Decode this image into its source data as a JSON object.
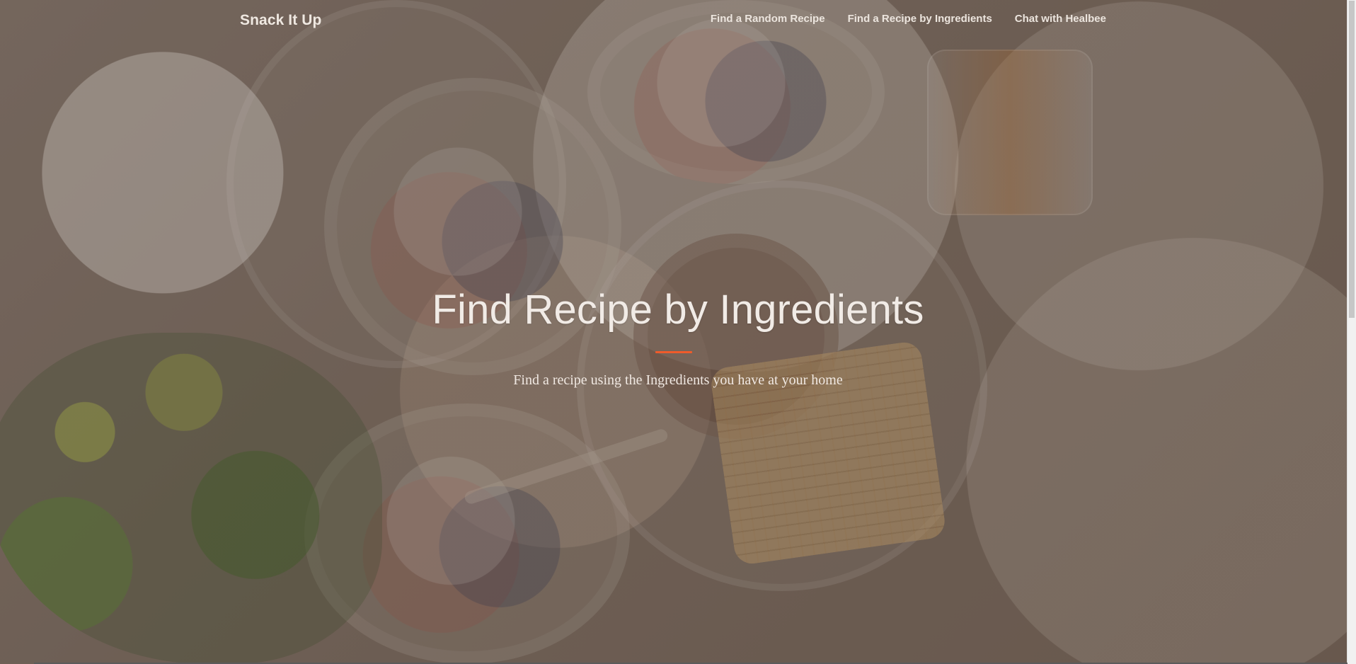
{
  "header": {
    "brand": "Snack It Up",
    "nav_items": [
      "Find a Random Recipe",
      "Find a Recipe by Ingredients",
      "Chat with Healbee"
    ]
  },
  "hero": {
    "title": "Find Recipe by Ingredients",
    "subtitle": "Find a recipe using the Ingredients you have at your home"
  },
  "colors": {
    "accent": "#ef5b2b",
    "overlay": "#6f6158"
  }
}
